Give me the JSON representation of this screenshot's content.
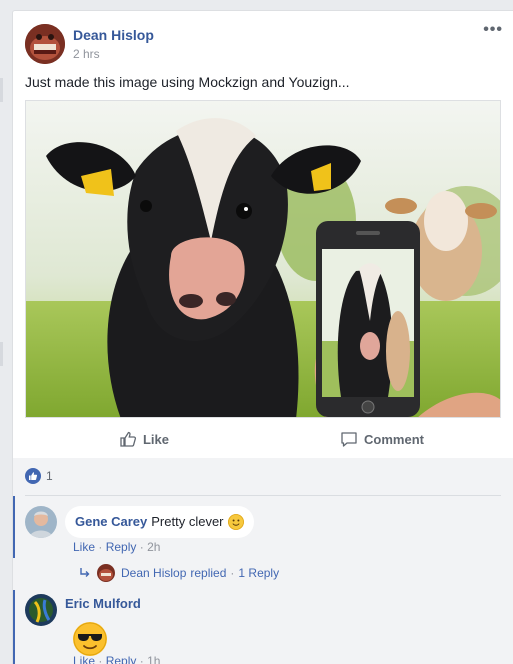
{
  "post": {
    "author": "Dean Hislop",
    "time": "2 hrs",
    "text": "Just made this image using Mockzign and Youzign...",
    "more_label": "•••",
    "actions": {
      "like": "Like",
      "comment": "Comment"
    }
  },
  "reactions": {
    "count": "1",
    "icon": "thumbs-up-icon"
  },
  "comments": [
    {
      "author": "Gene Carey",
      "text": "Pretty clever",
      "emoji": "slightly-smiling-face",
      "actions": {
        "like": "Like",
        "reply": "Reply",
        "time": "2h"
      },
      "reply_summary": {
        "author": "Dean Hislop",
        "action": "replied",
        "count": "1 Reply"
      }
    },
    {
      "author": "Eric Mulford",
      "emoji": "sunglasses-face",
      "actions": {
        "like": "Like",
        "reply": "Reply",
        "time": "1h"
      }
    }
  ],
  "colors": {
    "link": "#365899",
    "accent": "#4267b2",
    "muted": "#90949c",
    "background": "#e9ebee"
  }
}
